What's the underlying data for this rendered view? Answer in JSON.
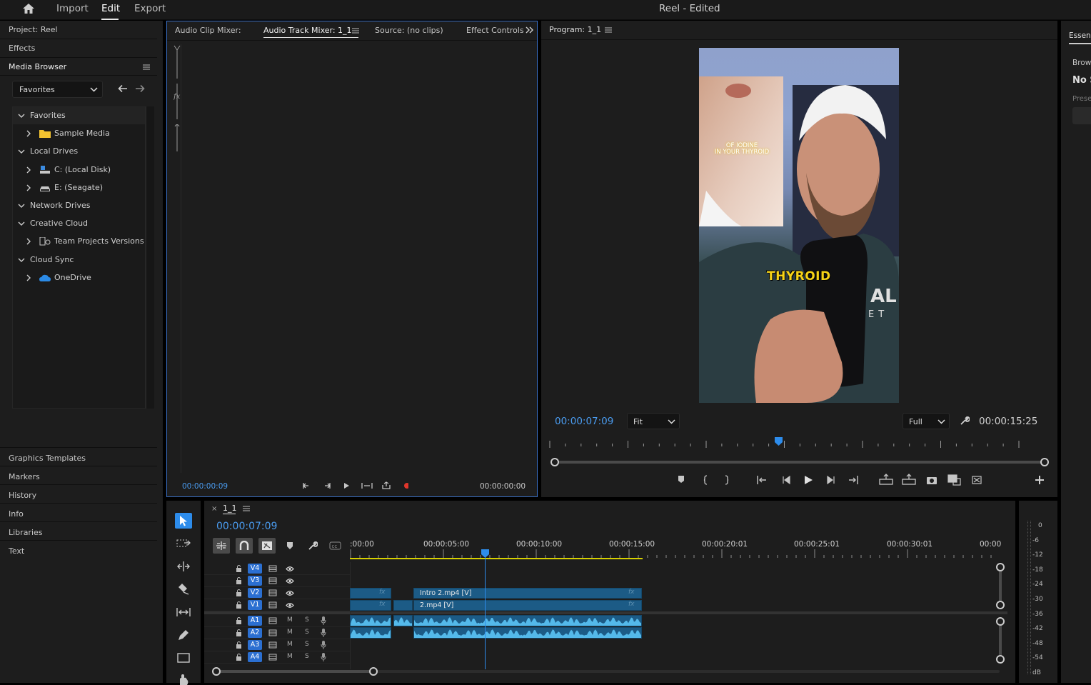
{
  "menu": {
    "import": "Import",
    "edit": "Edit",
    "export": "Export",
    "title": "Reel - Edited"
  },
  "left_panels": {
    "project": "Project: Reel",
    "effects": "Effects",
    "media_browser": "Media Browser"
  },
  "media_browser": {
    "favorites_dropdown": "Favorites",
    "tree": [
      {
        "label": "Favorites",
        "indent": 0,
        "expanded": true,
        "icon": ""
      },
      {
        "label": "Sample Media",
        "indent": 1,
        "expanded": false,
        "icon": "folder-icon"
      },
      {
        "label": "Local Drives",
        "indent": 0,
        "expanded": true,
        "icon": ""
      },
      {
        "label": "C: (Local Disk)",
        "indent": 1,
        "expanded": false,
        "icon": "local-disk-icon"
      },
      {
        "label": "E: (Seagate)",
        "indent": 1,
        "expanded": false,
        "icon": "drive-icon"
      },
      {
        "label": "Network Drives",
        "indent": 0,
        "expanded": true,
        "icon": ""
      },
      {
        "label": "Creative Cloud",
        "indent": 0,
        "expanded": true,
        "icon": ""
      },
      {
        "label": "Team Projects Versions",
        "indent": 1,
        "expanded": false,
        "icon": "team-projects-icon"
      },
      {
        "label": "Cloud Sync",
        "indent": 0,
        "expanded": true,
        "icon": ""
      },
      {
        "label": "OneDrive",
        "indent": 1,
        "expanded": false,
        "icon": "onedrive-icon"
      }
    ]
  },
  "lower_left_panels": [
    "Graphics Templates",
    "Markers",
    "History",
    "Info",
    "Libraries",
    "Text"
  ],
  "source_panel": {
    "tabs": [
      "Audio Clip Mixer:",
      "Audio Track Mixer: 1_1",
      "Source: (no clips)",
      "Effect Controls"
    ],
    "active_tab": "Audio Track Mixer: 1_1",
    "timecode_left": "00:00:00:09",
    "timecode_right": "00:00:00:00"
  },
  "program": {
    "tab": "Program: 1_1",
    "timecode": "00:00:07:09",
    "zoom": "Fit",
    "resolution": "Full",
    "duration": "00:00:15:25",
    "playhead_fraction": 0.463,
    "overlay_text_small": "OF IODINE\nIN YOUR THYROID",
    "overlay_text_big": "THYROID",
    "shirt_text_1": "AL",
    "shirt_text_2": "ET"
  },
  "essentials": {
    "tab": "Essent",
    "line1": "Brow",
    "line2": "No S",
    "line3": "Prese"
  },
  "timeline": {
    "sequence": "1_1",
    "timecode": "00:00:07:09",
    "ruler": [
      ":00:00",
      "00:00:05:00",
      "00:00:10:00",
      "00:00:15:00",
      "00:00:20:01",
      "00:00:25:01",
      "00:00:30:01",
      "00:00"
    ],
    "video_tracks": [
      "V4",
      "V3",
      "V2",
      "V1"
    ],
    "audio_tracks": [
      "A1",
      "A2",
      "A3",
      "A4"
    ],
    "clip_v2": "Intro 2.mp4 [V]",
    "clip_v1": "2.mp4 [V]",
    "fx": "fx",
    "mute": "M",
    "solo": "S"
  },
  "meter": {
    "labels": [
      "0",
      "-6",
      "-12",
      "-18",
      "-24",
      "-30",
      "-36",
      "-42",
      "-48",
      "-54",
      "dB"
    ]
  },
  "colors": {
    "accent": "#2d8ceb",
    "timecode_blue": "#4a9cf0",
    "clip_blue": "#1c5b86",
    "audio_blue": "#54b9ea",
    "record_red": "#e0362b",
    "work_area_yellow": "#d6d000"
  }
}
